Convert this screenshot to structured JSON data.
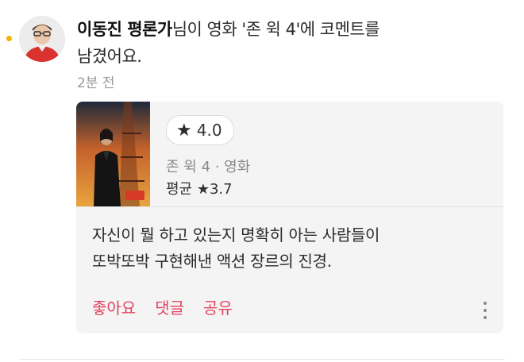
{
  "feed_item": {
    "author_name": "이동진 평론가",
    "headline_rest_line1": "님이 영화 '존 윅 4'에 코멘트를",
    "headline_rest_line2": "남겼어요.",
    "timestamp": "2분 전"
  },
  "movie_card": {
    "my_rating": "4.0",
    "meta": "존 윅 4 · 영화",
    "average_label": "평균 ★3.7",
    "comment_line1": "자신이 뭘 하고 있는지 명확히 아는 사람들이",
    "comment_line2": "또박또박 구현해낸 액션 장르의 진경."
  },
  "actions": {
    "like": "좋아요",
    "reply": "댓글",
    "share": "공유"
  },
  "colors": {
    "accent": "#e2445f",
    "unread_dot": "#f2b400",
    "card_bg": "#f4f4f4"
  }
}
